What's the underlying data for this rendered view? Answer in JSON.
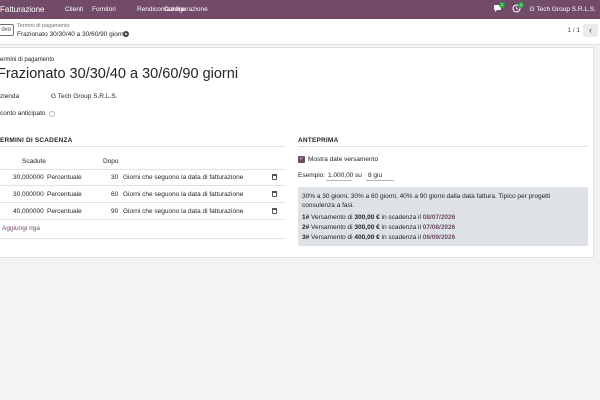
{
  "navbar": {
    "app_name": "Fatturazione",
    "menu": [
      "Clienti",
      "Fornitori",
      "Rendicontazione",
      "Configurazione"
    ],
    "chat_count": "1",
    "activity_count": "4",
    "company": "G Tech Group S.R.L.S."
  },
  "control": {
    "new_label": "ovo",
    "breadcrumb_parent": "Termini di pagamento",
    "breadcrumb_current": "Frazionato 30/30/40 a 30/60/90 giorni",
    "pager": "1 / 1"
  },
  "form": {
    "name_label": "ermini di pagamento",
    "name": "Frazionato 30/30/40 a 30/60/90 giorni",
    "company_label": "zienda",
    "company_value": "G Tech Group S.R.L.S.",
    "early_discount_label": "conto anticipato"
  },
  "terms": {
    "section_title": "ERMINI DI SCADENZA",
    "headers": {
      "due": "Scadute",
      "after": "Dopo"
    },
    "rows": [
      {
        "value": "30,000000",
        "type": "Percentuale",
        "days": "30",
        "option": "Giorni che seguono la data di fatturazione"
      },
      {
        "value": "30,000000",
        "type": "Percentuale",
        "days": "60",
        "option": "Giorni che seguono la data di fatturazione"
      },
      {
        "value": "40,000000",
        "type": "Percentuale",
        "days": "90",
        "option": "Giorni che seguono la data di fatturazione"
      }
    ],
    "add_line": "Aggiungi riga"
  },
  "preview": {
    "section_title": "ANTEPRIMA",
    "show_dates_label": "Mostra date versamento",
    "example_label": "Esempio:",
    "example_amount": "1.000,00",
    "on_label": "su",
    "example_date": "8 giu",
    "description": "30% a 30 giorni, 30% a 60 giorni, 40% a 90 giorni dalla data fattura. Tipico per progetti consulenza a fasi.",
    "installments": [
      {
        "num": "1#",
        "text1": "Versamento di",
        "amount": "300,00 €",
        "text2": "in scadenza il",
        "date": "08/07/2026"
      },
      {
        "num": "2#",
        "text1": "Versamento di",
        "amount": "300,00 €",
        "text2": "in scadenza il",
        "date": "07/08/2026"
      },
      {
        "num": "3#",
        "text1": "Versamento di",
        "amount": "400,00 €",
        "text2": "in scadenza il",
        "date": "06/09/2026"
      }
    ]
  }
}
